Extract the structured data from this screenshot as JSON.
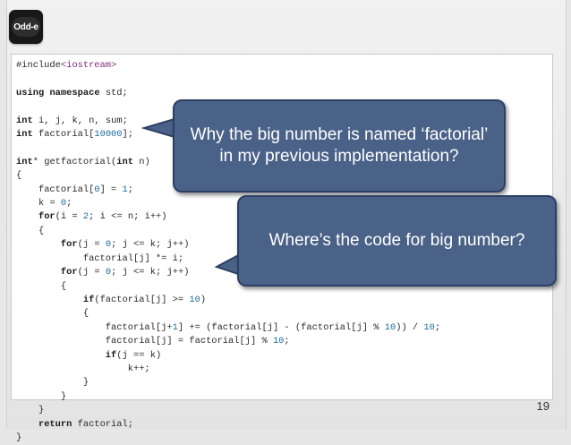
{
  "slide": {
    "logo_text": "Odd-e",
    "page_number": "19"
  },
  "code": {
    "lines": [
      "#include<iostream>",
      "",
      "using namespace std;",
      "",
      "int i, j, k, n, sum;",
      "int factorial[10000];",
      "",
      "int* getfactorial(int n)",
      "{",
      "    factorial[0] = 1;",
      "    k = 0;",
      "    for(i = 2; i <= n; i++)",
      "    {",
      "        for(j = 0; j <= k; j++)",
      "            factorial[j] *= i;",
      "        for(j = 0; j <= k; j++)",
      "        {",
      "            if(factorial[j] >= 10)",
      "            {",
      "                factorial[j+1] += (factorial[j] - (factorial[j] % 10)) / 10;",
      "                factorial[j] = factorial[j] % 10;",
      "                if(j == k)",
      "                    k++;",
      "            }",
      "        }",
      "    }",
      "    return factorial;",
      "}"
    ]
  },
  "callouts": [
    {
      "line1": "Why the big number is named ‘factorial’",
      "line2": "in my previous implementation?"
    },
    {
      "line1": "Where’s the code for big number?"
    }
  ],
  "colors": {
    "callout_fill": "#4b6288",
    "callout_border": "#2c4063",
    "keyword": "#1a1a1a",
    "number": "#1c6ba0",
    "include_target": "#7a2a7a"
  }
}
